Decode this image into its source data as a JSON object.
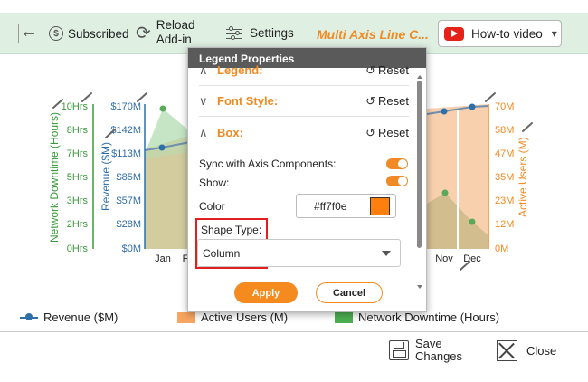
{
  "toolbar": {
    "subscribed_label": "Subscribed",
    "reload_label": "Reload Add-in",
    "settings_label": "Settings",
    "chart_title": "Multi Axis Line C...",
    "howto_label": "How-to video"
  },
  "chart": {
    "axis_downtime": {
      "title": "Network Downtime (Hours)",
      "ticks": [
        "10Hrs",
        "8Hrs",
        "7Hrs",
        "5Hrs",
        "3Hrs",
        "2Hrs",
        "0Hrs"
      ],
      "color": "#3a9a3a"
    },
    "axis_revenue": {
      "title": "Revenue ($M)",
      "ticks": [
        "$170M",
        "$142M",
        "$113M",
        "$85M",
        "$57M",
        "$28M",
        "$0M"
      ],
      "color": "#2f6fa8"
    },
    "axis_users": {
      "title": "Active Users (M)",
      "ticks": [
        "70M",
        "58M",
        "47M",
        "35M",
        "23M",
        "12M",
        "0M"
      ],
      "color": "#f08a24"
    },
    "x_labels": [
      "Jan",
      "F",
      "Nov",
      "Dec"
    ],
    "legend": {
      "revenue": "Revenue ($M)",
      "active_users": "Active Users (M)",
      "downtime": "Network Downtime (Hours)"
    }
  },
  "dialog": {
    "title": "Legend Properties",
    "sections": [
      {
        "title": "Legend:",
        "reset": "Reset"
      },
      {
        "title": "Font Style:",
        "reset": "Reset"
      },
      {
        "title": "Box:",
        "reset": "Reset"
      }
    ],
    "sync_label": "Sync with Axis Components:",
    "show_label": "Show:",
    "color_label": "Color",
    "color_value": "#ff7f0e",
    "shape_type_label": "Shape Type:",
    "shape_type_value": "Column",
    "apply_label": "Apply",
    "cancel_label": "Cancel",
    "sync_on": true,
    "show_on": true
  },
  "bottom": {
    "save_label": "Save Changes",
    "close_label": "Close"
  },
  "colors": {
    "accent": "#f08a24",
    "toolbar_bg": "#dff0e2",
    "revenue": "#2f6fa8",
    "downtime": "#3a9a3a",
    "users": "#f7a560"
  }
}
